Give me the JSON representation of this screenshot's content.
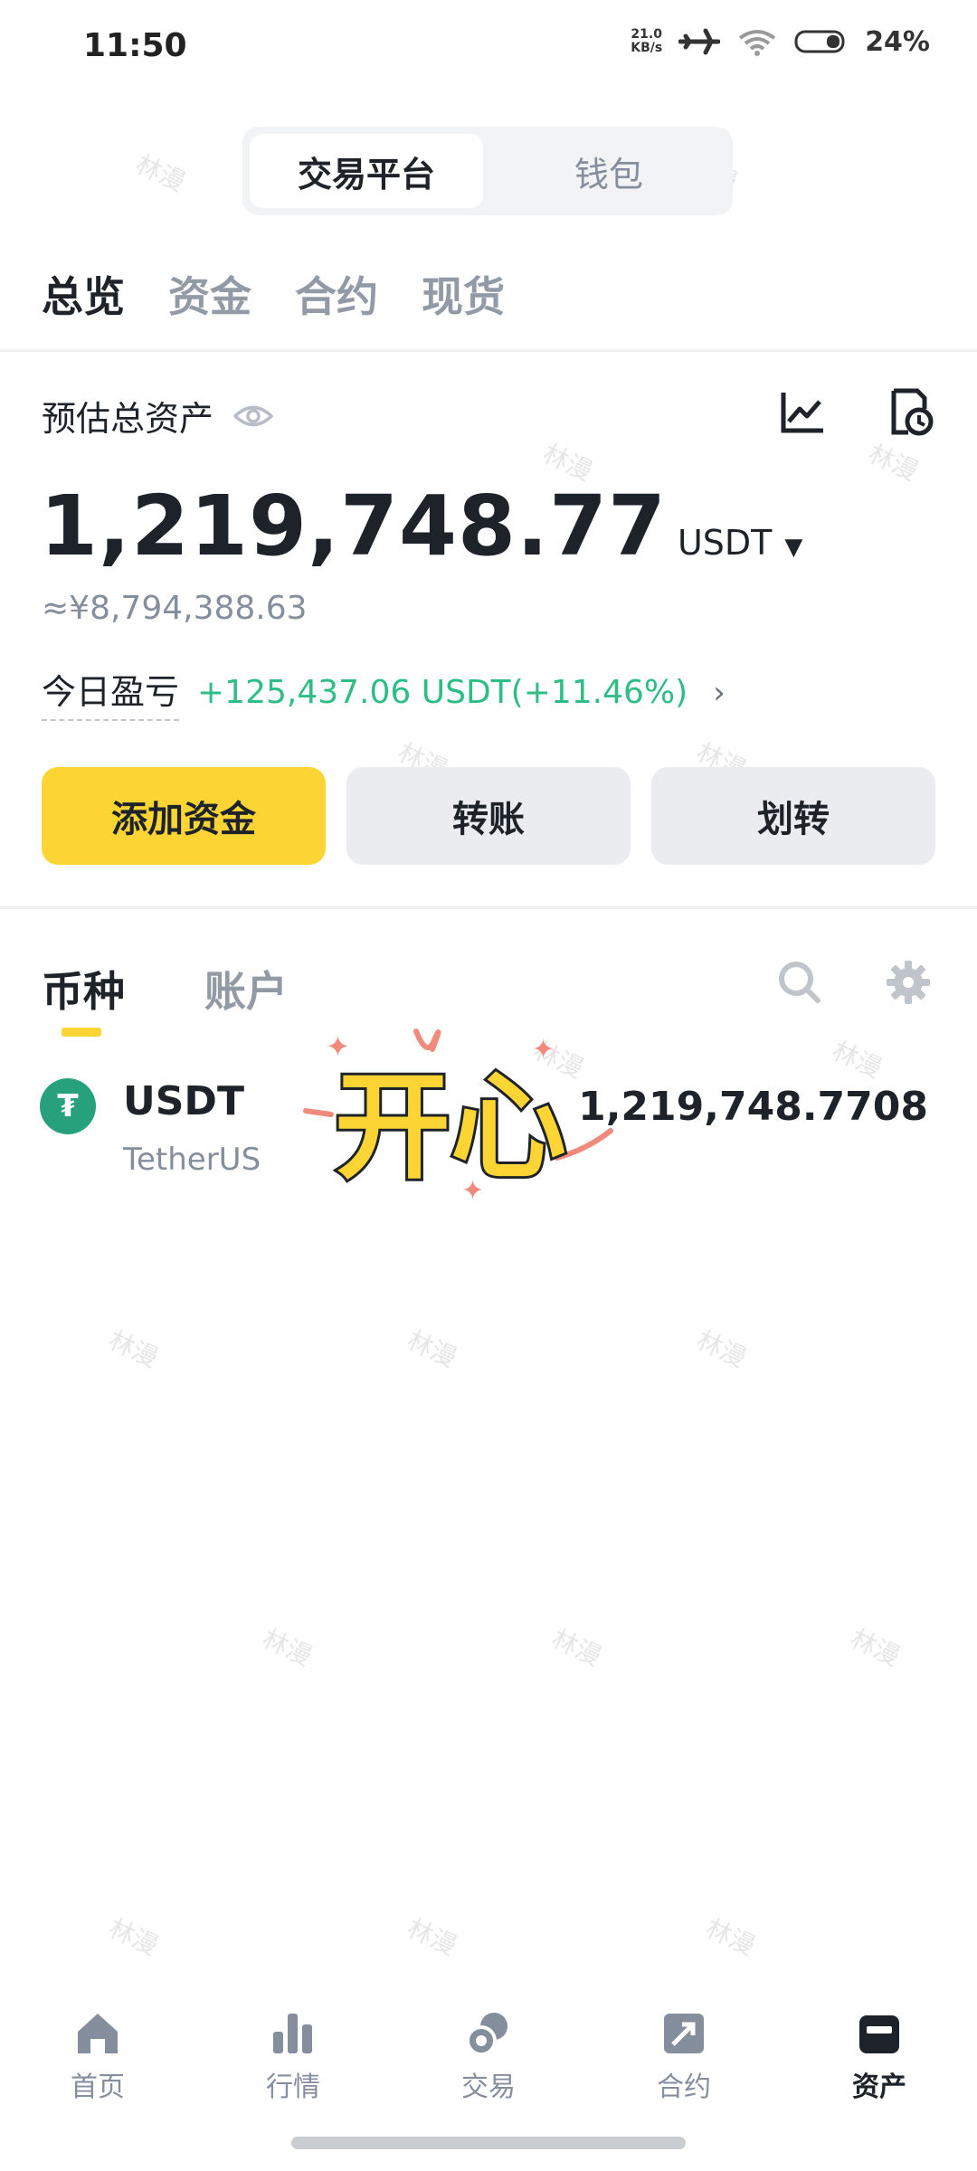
{
  "status_bar": {
    "time": "11:50",
    "net_speed_top": "21.0",
    "net_speed_bottom": "KB/s",
    "battery": "24%"
  },
  "segment": {
    "options": [
      "交易平台",
      "钱包"
    ],
    "active_index": 0
  },
  "tabs": [
    "总览",
    "资金",
    "合约",
    "现货"
  ],
  "overview": {
    "estimated_label": "预估总资产",
    "total": "1,219,748.77",
    "unit": "USDT",
    "caret": "▼",
    "cny": "≈¥8,794,388.63",
    "pnl_label": "今日盈亏",
    "pnl_value": "+125,437.06 USDT(+11.46%)",
    "pnl_chevron": "›"
  },
  "actions": {
    "add_funds": "添加资金",
    "transfer": "转账",
    "move": "划转"
  },
  "subtabs": [
    "币种",
    "账户"
  ],
  "coins": [
    {
      "symbol": "USDT",
      "name": "TetherUS",
      "amount": "1,219,748.7708",
      "icon_glyph": "₮"
    }
  ],
  "sticker_text": "开心",
  "watermark_text": "林漫",
  "bottom_nav": [
    {
      "label": "首页",
      "icon": "home-icon"
    },
    {
      "label": "行情",
      "icon": "bar-chart-icon"
    },
    {
      "label": "交易",
      "icon": "trade-icon"
    },
    {
      "label": "合约",
      "icon": "futures-icon"
    },
    {
      "label": "资产",
      "icon": "wallet-icon"
    }
  ],
  "colors": {
    "accent": "#fcd535",
    "positive": "#2ebd85",
    "muted": "#848e9c",
    "coin": "#26a17b"
  }
}
